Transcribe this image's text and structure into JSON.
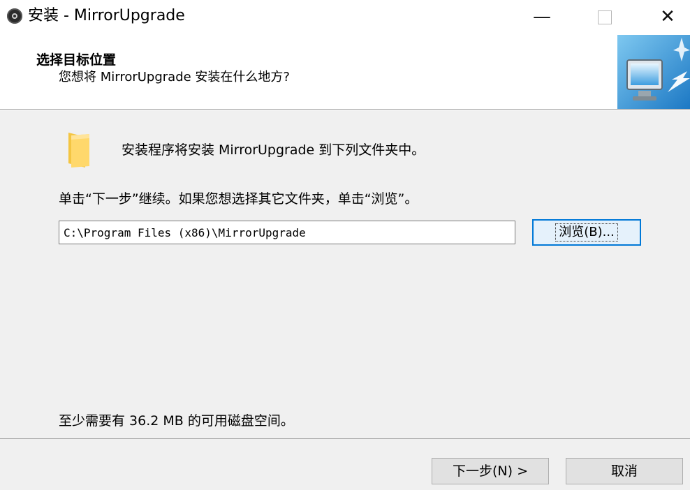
{
  "window": {
    "title": "安装 - MirrorUpgrade",
    "minimize_glyph": "—",
    "maximize_glyph": "",
    "close_glyph": "✕"
  },
  "header": {
    "heading": "选择目标位置",
    "subheading": "您想将 MirrorUpgrade 安装在什么地方?",
    "graphic_icon": "computer-install-icon"
  },
  "content": {
    "folder_icon": "folder-icon",
    "info_text": "安装程序将安装 MirrorUpgrade 到下列文件夹中。",
    "instruction_text": "单击“下一步”继续。如果您想选择其它文件夹，单击“浏览”。",
    "path_value": "C:\\Program Files (x86)\\MirrorUpgrade",
    "browse_label": "浏览(B)...",
    "disk_space_text": "至少需要有 36.2 MB 的可用磁盘空间。"
  },
  "footer": {
    "next_label": "下一步(N) >",
    "cancel_label": "取消"
  },
  "colors": {
    "content_bg": "#f0f0f0",
    "focus_border": "#0078d7",
    "focus_fill": "#e5f1fb",
    "button_fill": "#e1e1e1"
  }
}
